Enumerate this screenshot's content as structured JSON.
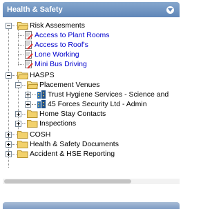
{
  "panel": {
    "title": "Health & Safety"
  },
  "tree": {
    "risk_assessments": {
      "label": "Risk Assesments",
      "children": [
        "Access to Plant Rooms",
        "Access to Roof's",
        "Lone Working",
        "Mini Bus Driving"
      ]
    },
    "hasps": {
      "label": "HASPS",
      "placement_venues": {
        "label": "Placement Venues",
        "children": [
          "Trust Hygiene Services - Science and",
          "45 Forces Security Ltd - Admin"
        ]
      },
      "home_stay_contacts": "Home Stay Contacts",
      "inspections": "Inspections"
    },
    "cosh": "COSH",
    "hs_documents": "Health & Safety Documents",
    "accident_reporting": "Accident & HSE Reporting"
  },
  "colors": {
    "header": "#6f93c2",
    "folder": "#f2d16b",
    "link": "#0000cc"
  }
}
